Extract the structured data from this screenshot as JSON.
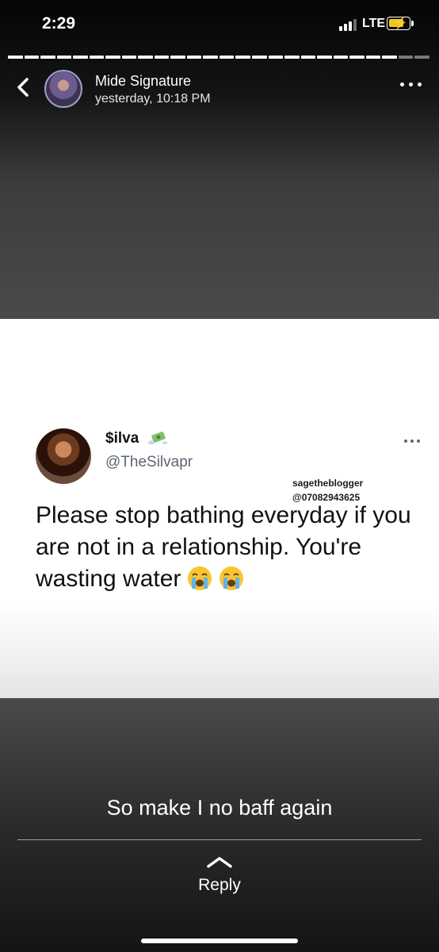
{
  "status_bar": {
    "time": "2:29",
    "network": "LTE",
    "battery_color": "#f5c518",
    "charging_icon": "bolt-icon"
  },
  "story_progress": {
    "segments_total": 26,
    "segments_viewed": 24
  },
  "header": {
    "back_icon": "chevron-left-icon",
    "name": "Mide Signature",
    "timestamp": "yesterday, 10:18 PM",
    "more_icon": "more-horizontal-icon"
  },
  "post": {
    "author_name": "$ilva",
    "author_emoji": "money-with-wings",
    "handle": "@TheSilvapr",
    "watermark_name": "sagetheblogger",
    "watermark_phone": "@07082943625",
    "tweet_text": "Please stop bathing everyday if you are not in a relationship. You're wasting water",
    "tweet_emoji": "loudly-crying-face"
  },
  "caption": "So make I no baff again",
  "reply": {
    "label": "Reply",
    "icon": "chevron-up-icon"
  }
}
